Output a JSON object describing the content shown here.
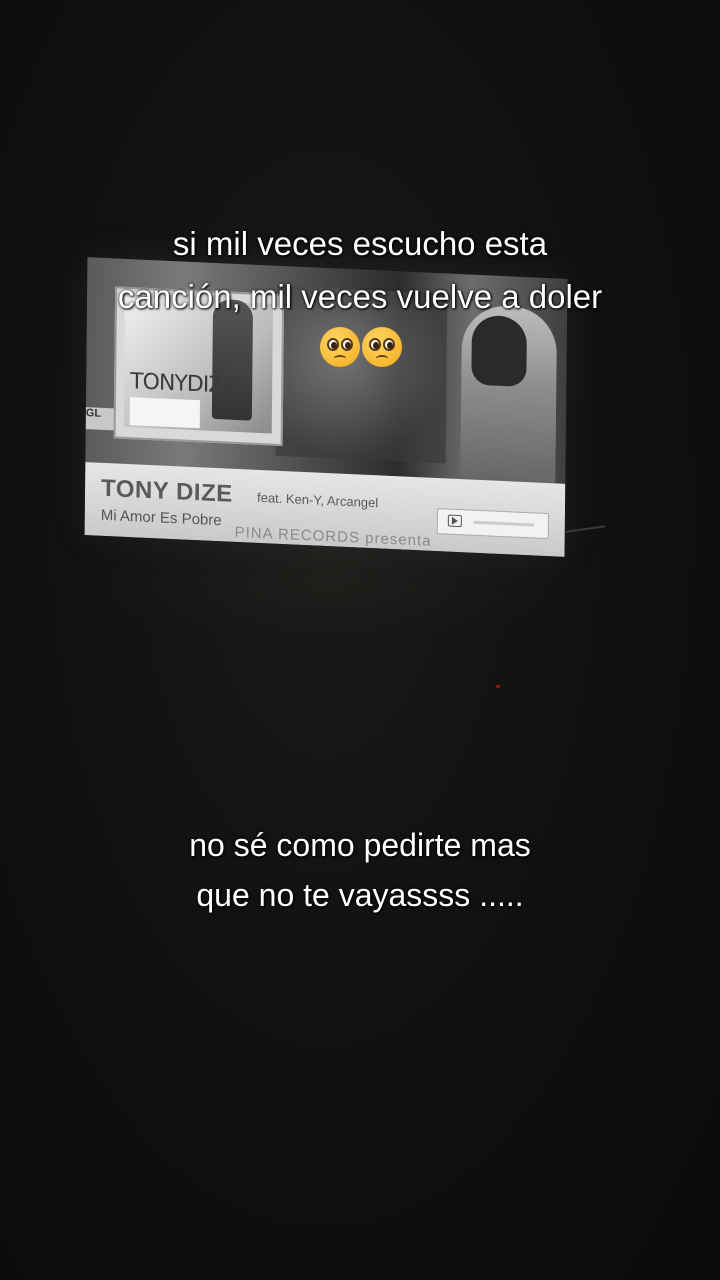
{
  "video_frame": {
    "album_art_text": "TONYDIZE",
    "left_strip_text": "GL",
    "artist": "TONY DIZE",
    "featuring": "feat. Ken-Y, Arcangel",
    "song_title": "Mi Amor Es Pobre",
    "label_text": "PINA RECORDS presenta"
  },
  "captions": {
    "top": "si mil veces escucho esta canción, mil veces vuelve a doler",
    "top_emojis": [
      "pleading-face",
      "pleading-face"
    ],
    "bottom_line1": "no sé como pedirte mas",
    "bottom_line2": "que no te vayassss ....."
  },
  "colors": {
    "background": "#0d0e0c",
    "caption_text": "#ffffff",
    "lower_third": "#d9d9d9"
  }
}
